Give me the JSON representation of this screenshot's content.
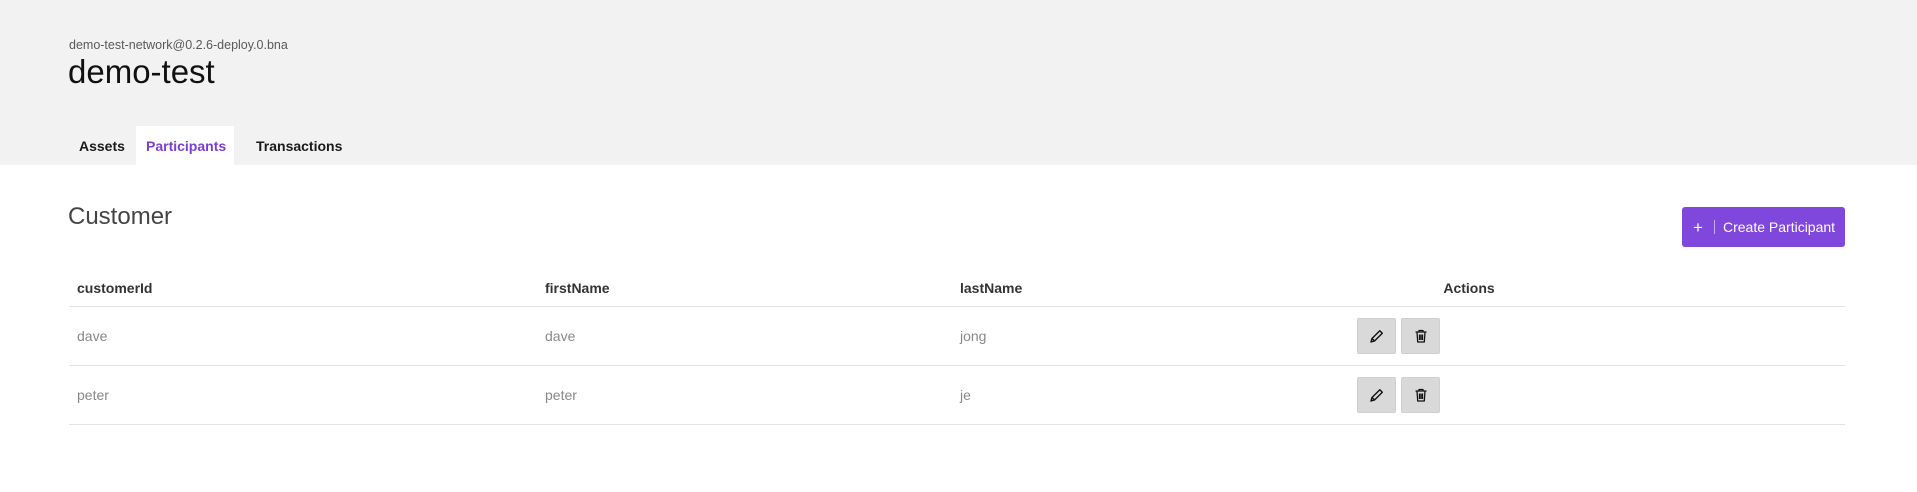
{
  "header": {
    "network": "demo-test-network@0.2.6-deploy.0.bna",
    "title": "demo-test"
  },
  "tabs": [
    {
      "label": "Assets",
      "active": false
    },
    {
      "label": "Participants",
      "active": true
    },
    {
      "label": "Transactions",
      "active": false
    }
  ],
  "section": {
    "title": "Customer",
    "create_label": "Create Participant",
    "create_icon": "plus-icon"
  },
  "table": {
    "columns": [
      "customerId",
      "firstName",
      "lastName",
      "Actions"
    ],
    "rows": [
      {
        "customerId": "dave",
        "firstName": "dave",
        "lastName": "jong"
      },
      {
        "customerId": "peter",
        "firstName": "peter",
        "lastName": "je"
      }
    ],
    "row_actions": [
      "pencil-icon",
      "trash-icon"
    ]
  },
  "colors": {
    "accent": "#8047dc",
    "active_tab": "#7b3fd0",
    "header_bg": "#f2f2f2"
  }
}
